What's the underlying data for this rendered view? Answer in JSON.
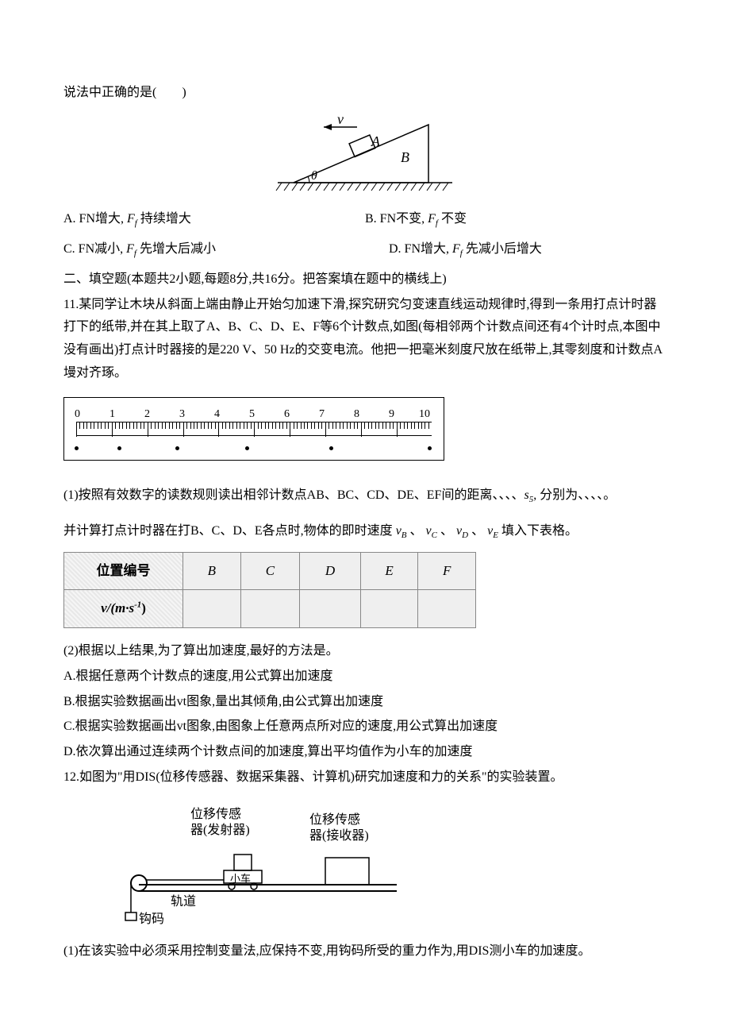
{
  "q10": {
    "stem": "说法中正确的是(　　)",
    "incline_labels": {
      "v": "v",
      "A": "A",
      "B": "B",
      "theta": "θ"
    },
    "optA": "A. FN增大, ",
    "optA_tail": " 持续增大",
    "optB": "B. FN不变, ",
    "optB_tail": " 不变",
    "optC": "C. FN减小, ",
    "optC_tail": " 先增大后减小",
    "optD": "D. FN增大, ",
    "optD_tail": " 先减小后增大",
    "Ff": "F",
    "Ff_sub": "f"
  },
  "section2": "二、填空题(本题共2小题,每题8分,共16分。把答案填在题中的横线上)",
  "q11": {
    "stem1": "11.某同学让木块从斜面上端由静止开始匀加速下滑,探究研究匀变速直线运动规律时,得到一条用打点计时器打下的纸带,并在其上取了A、B、C、D、E、F等6个计数点,如图(每相邻两个计数点间还有4个计时点,本图中没有画出)打点计时器接的是220 V、50 Hz的交变电流。他把一把毫米刻度尺放在纸带上,其零刻度和计数点A墁对齐琢。",
    "ruler_nums": [
      "0",
      "1",
      "2",
      "3",
      "4",
      "5",
      "6",
      "7",
      "8",
      "9",
      "10"
    ],
    "p1_a": "(1)按照有效数字的读数规则读出相邻计数点AB、BC、CD、DE、EF间的距离、、、、",
    "s5": "s",
    "s5_sub": "5",
    "p1_b": ", 分别为、、、、。",
    "p1_c": "并计算打点计时器在打B、C、D、E各点时,物体的即时速度",
    "vB": "v",
    "vB_sub": "B",
    "vC": "v",
    "vC_sub": "C",
    "vD": "v",
    "vD_sub": "D",
    "vE": "v",
    "vE_sub": "E",
    "p1_d": "填入下表格。",
    "table_h0": "位置编号",
    "table_h": [
      "B",
      "C",
      "D",
      "E",
      "F"
    ],
    "table_r0": "v/(m·s",
    "table_r0_sup": "-1",
    "table_r0_tail": ")",
    "p2": "(2)根据以上结果,为了算出加速度,最好的方法是。",
    "p2A": "A.根据任意两个计数点的速度,用公式算出加速度",
    "p2B": "B.根据实验数据画出vt图象,量出其倾角,由公式算出加速度",
    "p2C": "C.根据实验数据画出vt图象,由图象上任意两点所对应的速度,用公式算出加速度",
    "p2D": "D.依次算出通过连续两个计数点间的加速度,算出平均值作为小车的加速度"
  },
  "q12": {
    "stem": "12.如图为\"用DIS(位移传感器、数据采集器、计算机)研究加速度和力的关系\"的实验装置。",
    "lbl_emitter1": "位移传感",
    "lbl_emitter2": "器(发射器)",
    "lbl_receiver1": "位移传感",
    "lbl_receiver2": "器(接收器)",
    "lbl_car": "小车",
    "lbl_track": "轨道",
    "lbl_hook": "钩码",
    "p1": "(1)在该实验中必须采用控制变量法,应保持不变,用钩码所受的重力作为,用DIS测小车的加速度。"
  }
}
